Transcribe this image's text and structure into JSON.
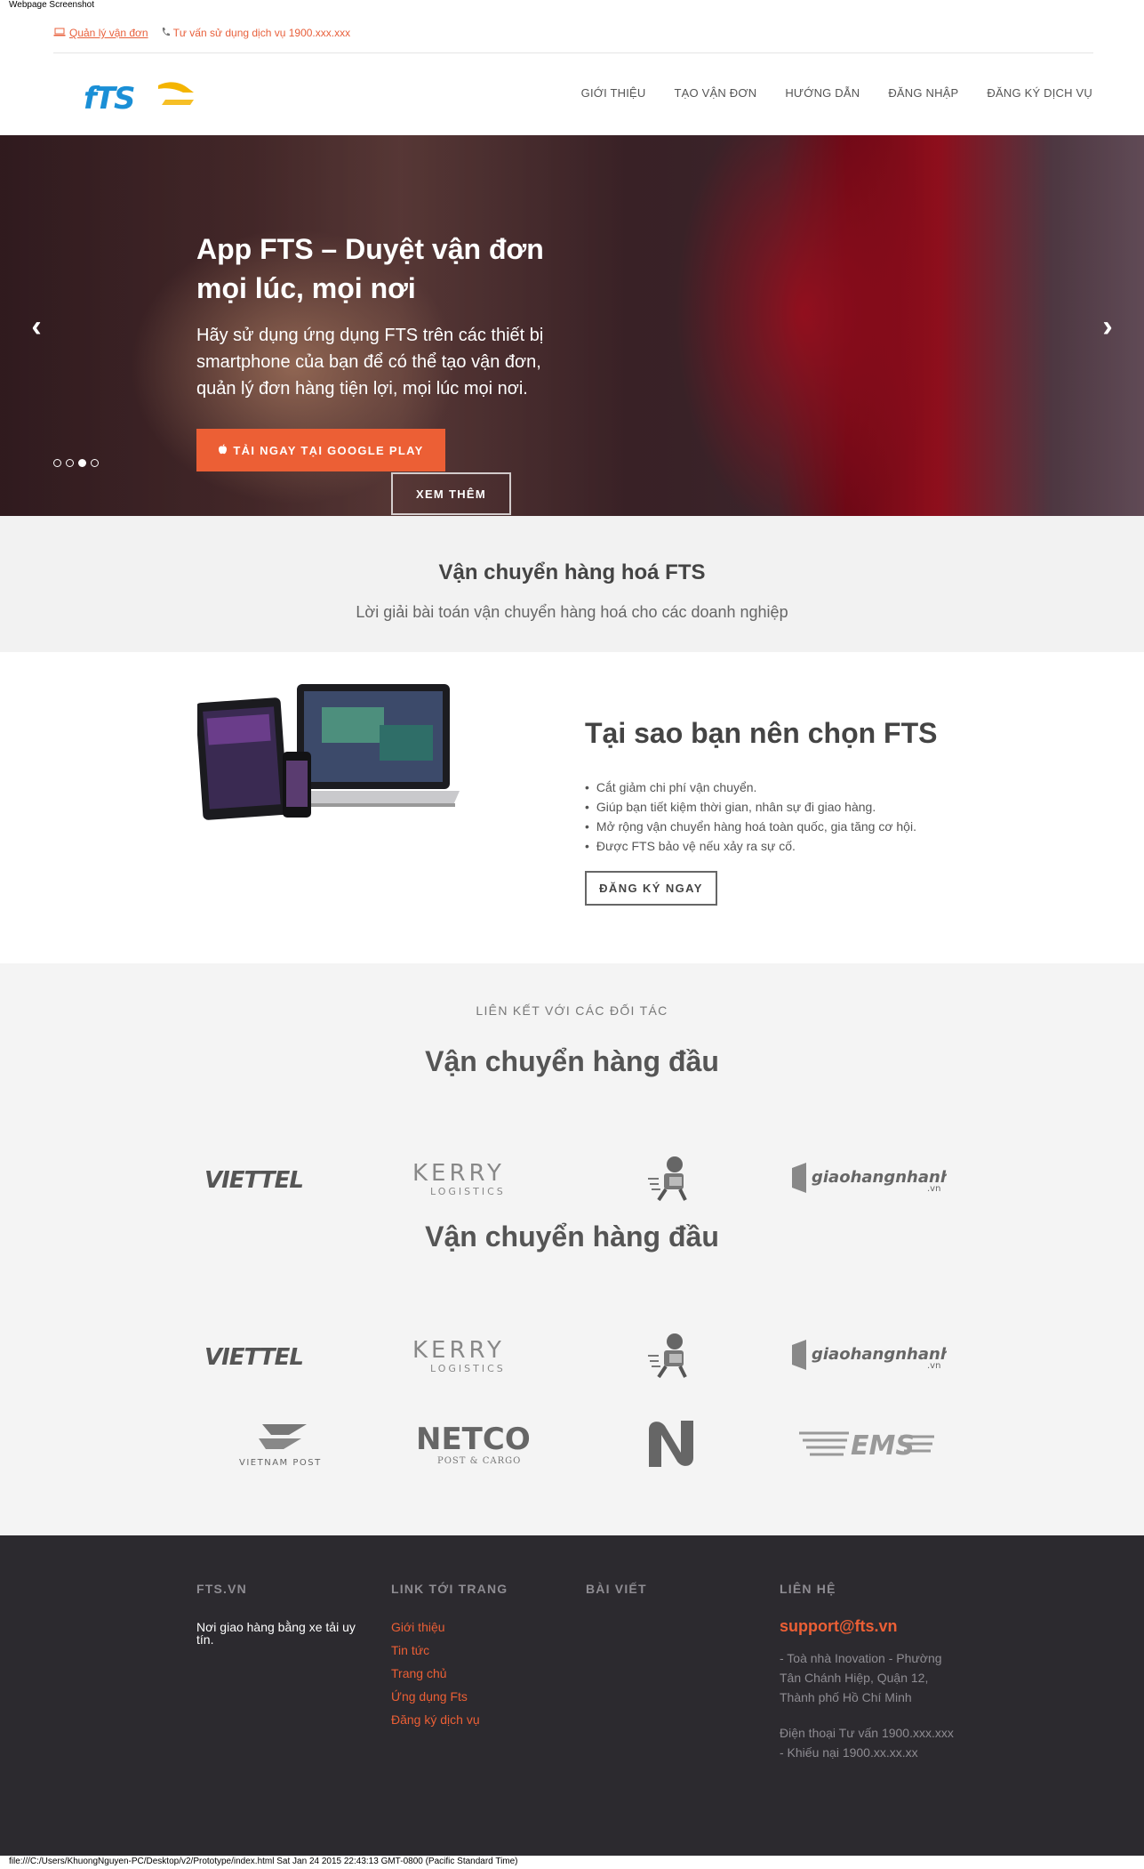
{
  "capture_label": "Webpage Screenshot",
  "topbar": {
    "manage_label": "Quản lý vận đơn",
    "hotline_label": "Tư vấn sử dụng dịch vụ 1900.xxx.xxx"
  },
  "brand": {
    "logo_text": "FTS",
    "accent": "#ec5f35",
    "logo_blue": "#1a8fd6",
    "logo_yellow": "#f4b400"
  },
  "nav": [
    "GIỚI THIỆU",
    "TẠO VẬN ĐƠN",
    "HƯỚNG DẪN",
    "ĐĂNG NHẬP",
    "ĐĂNG KÝ DỊCH VỤ"
  ],
  "hero": {
    "title": "App FTS – Duyệt vận đơn mọi lúc, mọi nơi",
    "text": "Hãy sử dụng ứng dụng FTS trên các thiết bị smartphone của bạn để có thể tạo vận đơn, quản lý đơn hàng tiện lợi, mọi lúc mọi nơi.",
    "primary_button": "TẢI NGAY TẠI GOOGLE PLAY",
    "secondary_button": "XEM THÊM",
    "slide_count": 4,
    "active_slide": 3
  },
  "intro": {
    "title": "Vận chuyển hàng hoá FTS",
    "subtitle": "Lời giải bài toán vận chuyển hàng hoá cho các doanh nghiệp"
  },
  "why": {
    "title": "Tại sao bạn nên chọn FTS",
    "points": [
      "Cắt giảm chi phí vận chuyển.",
      "Giúp bạn tiết kiệm thời gian, nhân sự đi giao hàng.",
      "Mở rộng vận chuyển hàng hoá toàn quốc, gia tăng cơ hội.",
      "Được FTS bảo vệ nếu xảy ra sự cố."
    ],
    "button": "ĐĂNG KÝ NGAY"
  },
  "partners": {
    "subtitle": "LIÊN KẾT VỚI CÁC ĐỐI TÁC",
    "heading_1": "Vận chuyển hàng đầu",
    "heading_2": "Vận chuyển hàng đầu",
    "logos": {
      "viettel": "VIETTEL",
      "kerry": "KERRY",
      "kerry_sub": "LOGISTICS",
      "ghn": "giaohangnhanh",
      "ghn_sub": ".vn",
      "vnpost": "VIETNAM POST",
      "netco": "NETCO",
      "netco_sub": "POST & CARGO",
      "ems": "EMS"
    }
  },
  "footer": {
    "col1": {
      "title": "FTS.VN",
      "text": "Nơi giao hàng bằng xe tải uy tín."
    },
    "col2": {
      "title": "LINK TỚI TRANG",
      "links": [
        "Giới thiệu",
        "Tin tức",
        "Trang chủ",
        "Ứng dụng Fts",
        "Đăng ký dịch vụ"
      ]
    },
    "col3": {
      "title": "BÀI VIẾT"
    },
    "col4": {
      "title": "LIÊN HỆ",
      "email": "support@fts.vn",
      "address": "- Toà nhà Inovation - Phường Tân Chánh Hiệp, Quận 12, Thành phố Hồ Chí Minh",
      "phone": "Điện thoại Tư vấn 1900.xxx.xxx - Khiếu nại 1900.xx.xx.xx"
    }
  },
  "file_line": "file:///C:/Users/KhuongNguyen-PC/Desktop/v2/Prototype/index.html Sat Jan 24 2015 22:43:13 GMT-0800 (Pacific Standard Time)"
}
